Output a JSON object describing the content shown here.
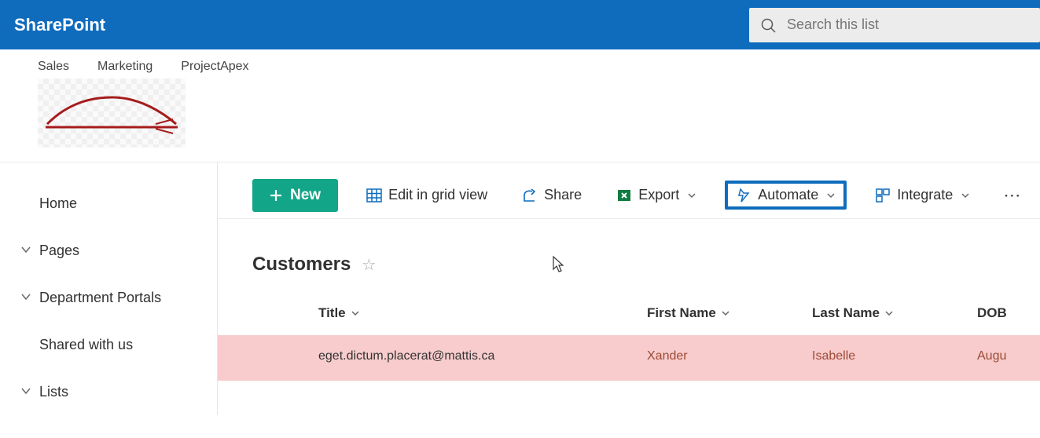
{
  "header": {
    "brand": "SharePoint"
  },
  "search": {
    "placeholder": "Search this list"
  },
  "siteNav": [
    "Sales",
    "Marketing",
    "ProjectApex"
  ],
  "leftNav": {
    "items": [
      {
        "label": "Home",
        "expandable": false
      },
      {
        "label": "Pages",
        "expandable": true
      },
      {
        "label": "Department Portals",
        "expandable": true
      },
      {
        "label": "Shared with us",
        "expandable": false
      },
      {
        "label": "Lists",
        "expandable": true
      }
    ]
  },
  "toolbar": {
    "new": "New",
    "grid": "Edit in grid view",
    "share": "Share",
    "export": "Export",
    "automate": "Automate",
    "integrate": "Integrate"
  },
  "list": {
    "title": "Customers",
    "columns": {
      "title": "Title",
      "first": "First Name",
      "last": "Last Name",
      "dob": "DOB"
    },
    "rows": [
      {
        "title": "eget.dictum.placerat@mattis.ca",
        "first": "Xander",
        "last": "Isabelle",
        "dob": "Augu"
      }
    ]
  },
  "colors": {
    "brand": "#0f6cbd",
    "accent": "#13a587",
    "rowBg": "#f8cccc"
  }
}
